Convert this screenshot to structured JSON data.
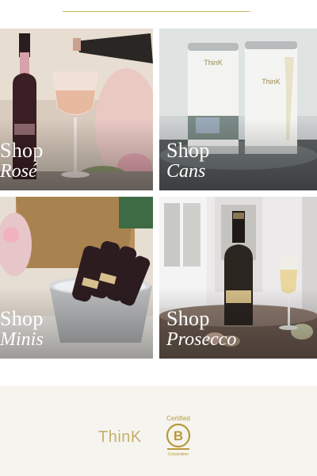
{
  "tiles": [
    {
      "shop": "Shop",
      "category": "Rosé",
      "icon": "rose-wine-photo"
    },
    {
      "shop": "Shop",
      "category": "Cans",
      "icon": "wine-cans-photo"
    },
    {
      "shop": "Shop",
      "category": "Minis",
      "icon": "mini-bottles-photo"
    },
    {
      "shop": "Shop",
      "category": "Prosecco",
      "icon": "prosecco-photo"
    }
  ],
  "footer": {
    "brand": "ThinK",
    "bcorp_certified": "Certified",
    "bcorp_letter": "B",
    "bcorp_corporation": "Corporation"
  },
  "colors": {
    "gold": "#c3b06a",
    "bcorp": "#b79a3a",
    "footer_bg": "#f6f4ef"
  }
}
